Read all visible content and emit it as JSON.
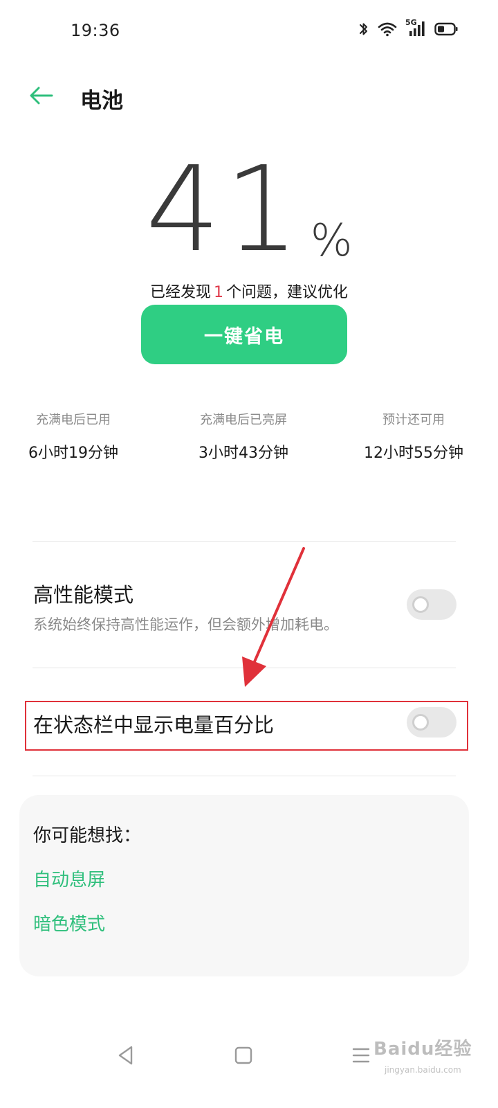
{
  "status_bar": {
    "time": "19:36",
    "network_label": "5G",
    "icons": [
      "bluetooth-icon",
      "wifi-icon",
      "cellular-5g-icon",
      "battery-icon"
    ]
  },
  "header": {
    "title": "电池",
    "back_icon": "arrow-left-icon"
  },
  "battery": {
    "level": "41",
    "unit": "%",
    "issue_prefix": "已经发现",
    "issue_count": "1",
    "issue_suffix": "个问题，建议优化",
    "optimize_button": "一键省电"
  },
  "stats": [
    {
      "label": "充满电后已用",
      "value": "6小时19分钟"
    },
    {
      "label": "充满电后已亮屏",
      "value": "3小时43分钟"
    },
    {
      "label": "预计还可用",
      "value": "12小时55分钟"
    }
  ],
  "settings": {
    "high_performance": {
      "title": "高性能模式",
      "subtitle": "系统始终保持高性能运作，但会额外增加耗电。",
      "enabled": false
    },
    "show_percentage": {
      "title": "在状态栏中显示电量百分比",
      "enabled": false
    }
  },
  "suggestions": {
    "title": "你可能想找：",
    "items": [
      "自动息屏",
      "暗色模式"
    ]
  },
  "nav_bar": {
    "icons": [
      "back-triangle-icon",
      "home-square-icon",
      "menu-lines-icon"
    ]
  },
  "watermark": {
    "brand": "Baidu经验",
    "url": "jingyan.baidu.com"
  },
  "colors": {
    "accent_green": "#2fce83",
    "link_green": "#2fbf7c",
    "issue_red": "#e0394a",
    "annotation_red": "#e0313a"
  }
}
